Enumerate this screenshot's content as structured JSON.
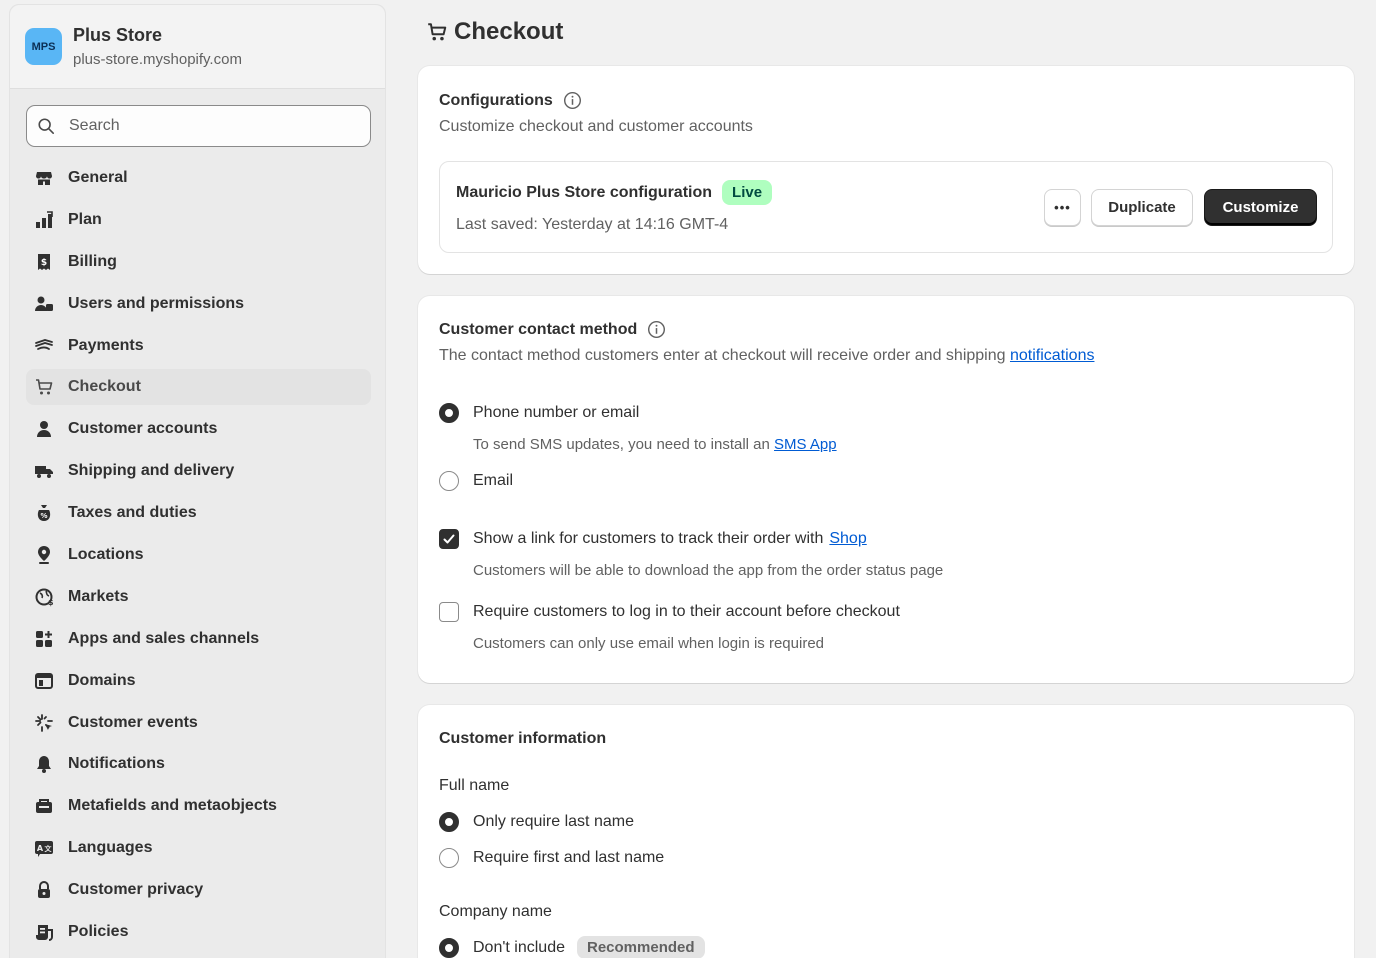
{
  "store": {
    "avatar": "MPS",
    "name": "Plus Store",
    "url": "plus-store.myshopify.com"
  },
  "search": {
    "placeholder": "Search"
  },
  "nav": [
    {
      "label": "General",
      "icon": "store-icon"
    },
    {
      "label": "Plan",
      "icon": "plan-chart-icon"
    },
    {
      "label": "Billing",
      "icon": "billing-receipt-icon"
    },
    {
      "label": "Users and permissions",
      "icon": "users-icon"
    },
    {
      "label": "Payments",
      "icon": "payments-icon"
    },
    {
      "label": "Checkout",
      "icon": "cart-icon",
      "active": true
    },
    {
      "label": "Customer accounts",
      "icon": "person-icon"
    },
    {
      "label": "Shipping and delivery",
      "icon": "truck-icon"
    },
    {
      "label": "Taxes and duties",
      "icon": "tax-bag-icon"
    },
    {
      "label": "Locations",
      "icon": "location-pin-icon"
    },
    {
      "label": "Markets",
      "icon": "globe-icon"
    },
    {
      "label": "Apps and sales channels",
      "icon": "apps-icon"
    },
    {
      "label": "Domains",
      "icon": "domains-icon"
    },
    {
      "label": "Customer events",
      "icon": "sparkle-icon"
    },
    {
      "label": "Notifications",
      "icon": "bell-icon"
    },
    {
      "label": "Metafields and metaobjects",
      "icon": "metafields-icon"
    },
    {
      "label": "Languages",
      "icon": "language-icon"
    },
    {
      "label": "Customer privacy",
      "icon": "lock-icon"
    },
    {
      "label": "Policies",
      "icon": "policies-icon"
    }
  ],
  "page": {
    "title": "Checkout"
  },
  "configurations": {
    "title": "Configurations",
    "subtitle": "Customize checkout and customer accounts",
    "config_name": "Mauricio Plus Store configuration",
    "status": "Live",
    "last_saved": "Last saved: Yesterday at 14:16 GMT-4",
    "more_label": "•••",
    "duplicate_label": "Duplicate",
    "customize_label": "Customize"
  },
  "contact": {
    "title": "Customer contact method",
    "subtitle": "The contact method customers enter at checkout will receive order and shipping",
    "subtitle_link": "notifications",
    "options": [
      {
        "label": "Phone number or email",
        "checked": true
      },
      {
        "label": "Email",
        "checked": false
      }
    ],
    "sms_help": "To send SMS updates, you need to install an",
    "sms_link": "SMS App",
    "track_label": "Show a link for customers to track their order with",
    "track_link": "Shop",
    "track_checked": true,
    "track_help": "Customers will be able to download the app from the order status page",
    "login_label": "Require customers to log in to their account before checkout",
    "login_checked": false,
    "login_help": "Customers can only use email when login is required"
  },
  "info": {
    "title": "Customer information",
    "full_name_label": "Full name",
    "full_name_options": [
      {
        "label": "Only require last name",
        "checked": true
      },
      {
        "label": "Require first and last name",
        "checked": false
      }
    ],
    "company_label": "Company name",
    "company_option": "Don't include",
    "company_badge": "Recommended"
  }
}
